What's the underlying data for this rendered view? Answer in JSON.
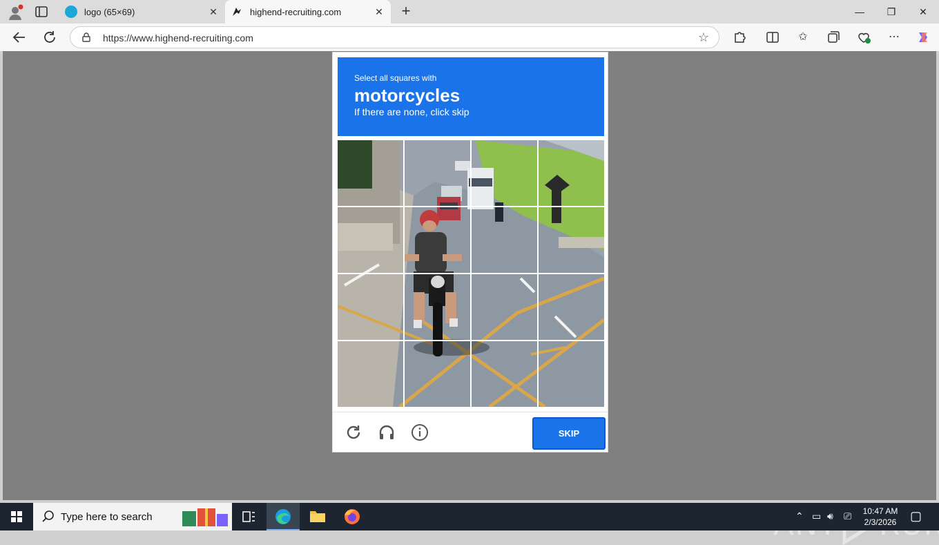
{
  "browser": {
    "tabs": [
      {
        "title": "logo (65×69)",
        "active": false
      },
      {
        "title": "highend-recruiting.com",
        "active": true
      }
    ],
    "url": "https://www.highend-recruiting.com"
  },
  "captcha": {
    "instruction_line1": "Select all squares with",
    "target": "motorcycles",
    "instruction_line3": "If there are none, click skip",
    "grid_rows": 4,
    "grid_cols": 4,
    "skip_label": "SKIP",
    "accent_color": "#1a73e8"
  },
  "watermark": {
    "text_left": "ANY",
    "text_right": "RUN"
  },
  "taskbar": {
    "search_placeholder": "Type here to search",
    "time": "10:47 AM",
    "date": "2/3/2026"
  }
}
